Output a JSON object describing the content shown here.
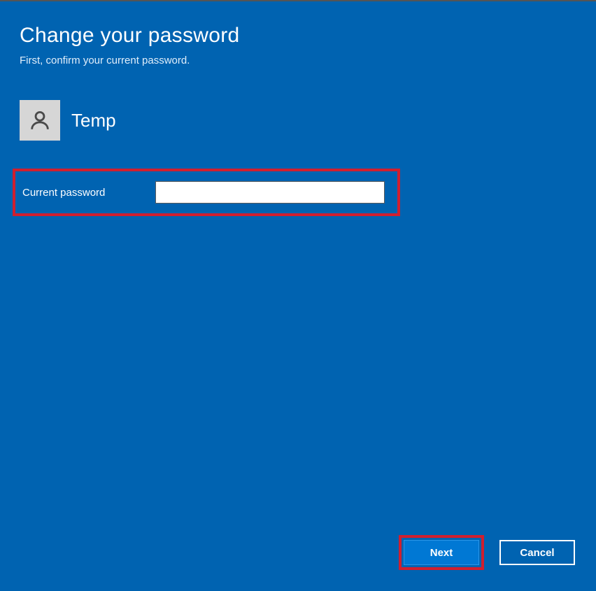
{
  "header": {
    "title": "Change your password",
    "subtitle": "First, confirm your current password."
  },
  "user": {
    "name": "Temp"
  },
  "form": {
    "current_password_label": "Current password",
    "current_password_value": ""
  },
  "buttons": {
    "next": "Next",
    "cancel": "Cancel"
  }
}
